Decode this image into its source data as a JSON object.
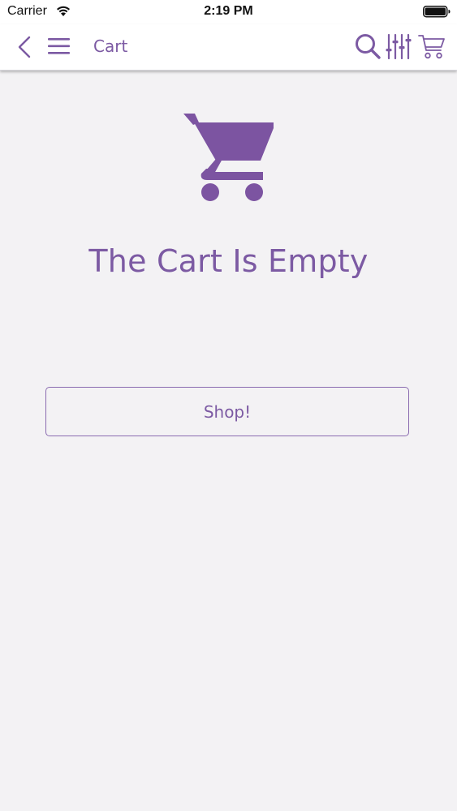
{
  "status_bar": {
    "carrier": "Carrier",
    "time": "2:19 PM"
  },
  "nav_bar": {
    "title": "Cart",
    "icons": [
      "back-chevron-icon",
      "menu-icon",
      "search-icon",
      "filter-icon",
      "cart-icon"
    ]
  },
  "empty_state": {
    "icon": "cart-icon",
    "title": "The Cart Is Empty",
    "button_label": "Shop!"
  },
  "colors": {
    "accent": "#7c5aa3",
    "background": "#f3f2f4",
    "bar_background": "#ffffff"
  }
}
